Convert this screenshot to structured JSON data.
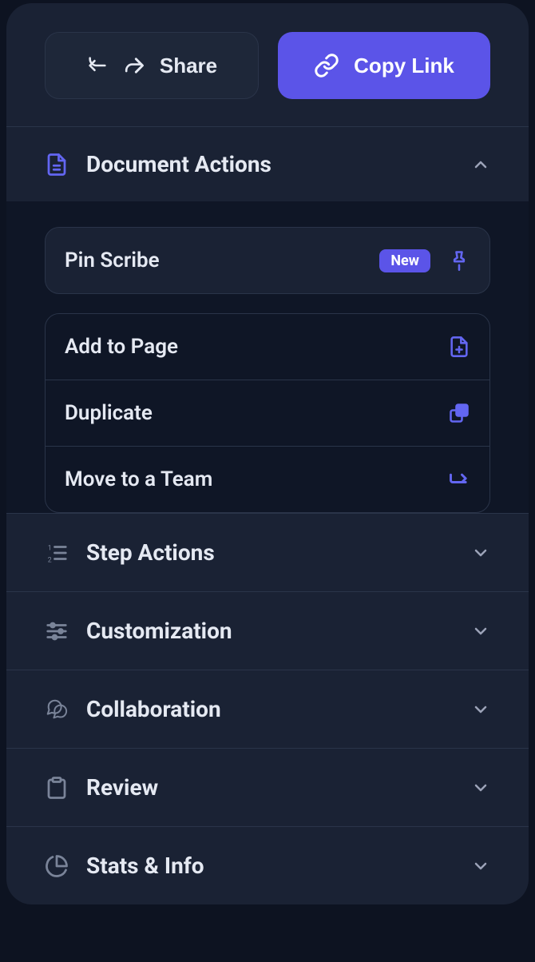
{
  "header": {
    "share_label": "Share",
    "copy_link_label": "Copy Link"
  },
  "sections": {
    "document_actions": {
      "title": "Document Actions",
      "items": {
        "pin_scribe": {
          "label": "Pin Scribe",
          "badge": "New"
        },
        "add_to_page": {
          "label": "Add to Page"
        },
        "duplicate": {
          "label": "Duplicate"
        },
        "move_to_team": {
          "label": "Move to a Team"
        }
      }
    },
    "step_actions": {
      "title": "Step Actions"
    },
    "customization": {
      "title": "Customization"
    },
    "collaboration": {
      "title": "Collaboration"
    },
    "review": {
      "title": "Review"
    },
    "stats_info": {
      "title": "Stats & Info"
    }
  }
}
